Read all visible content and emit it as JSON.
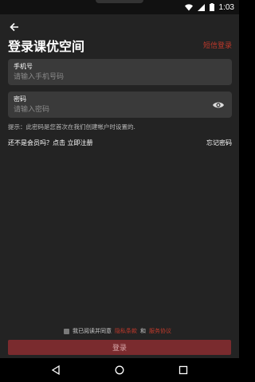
{
  "status_bar": {
    "time": "1:03",
    "icons": [
      "wifi-icon",
      "signal-icon",
      "battery-icon"
    ]
  },
  "header": {
    "title": "登录课优空间",
    "sms_login": "短信登录"
  },
  "phone_field": {
    "label": "手机号",
    "placeholder": "请输入手机号码",
    "value": ""
  },
  "password_field": {
    "label": "密码",
    "placeholder": "请输入密码",
    "value": ""
  },
  "hint": "提示：此密码是您首次在我们创建帐户时设置的.",
  "register": {
    "prompt": "还不是会员吗？点击 立即注册"
  },
  "forgot_password": "忘记密码",
  "agreement": {
    "prefix": "我已阅读并同意",
    "privacy": "隐私条款",
    "and": "和",
    "service": "服务协议"
  },
  "login_button": "登录",
  "colors": {
    "accent": "#c0392b",
    "button_bg": "#7a2b2e",
    "page_bg": "#232323",
    "field_bg": "#3a3a3a"
  }
}
